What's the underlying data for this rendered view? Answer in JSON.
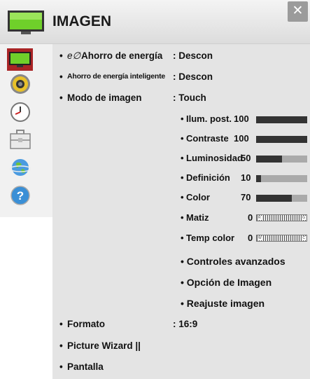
{
  "header": {
    "title": "IMAGEN",
    "close_icon": "close-icon"
  },
  "sidebar": [
    {
      "icon": "tv-picture-icon",
      "active": true
    },
    {
      "icon": "speaker-audio-icon"
    },
    {
      "icon": "clock-time-icon"
    },
    {
      "icon": "toolbox-options-icon"
    },
    {
      "icon": "globe-network-icon"
    },
    {
      "icon": "help-question-icon"
    }
  ],
  "menu": {
    "energy": {
      "bullet": "•",
      "eco": "e∅",
      "label": "Ahorro de energía",
      "value": ": Descon"
    },
    "smart_energy": {
      "bullet": "•",
      "label": "Ahorro de energía inteligente",
      "value": ": Descon"
    },
    "mode": {
      "bullet": "•",
      "label": "Modo de imagen",
      "value": ": Touch"
    },
    "settings": [
      {
        "label": "Ilum. post.",
        "value": "100",
        "level": 1.0
      },
      {
        "label": "Contraste",
        "value": "100",
        "level": 1.0
      },
      {
        "label": "Luminosidad",
        "value": "50",
        "level": 0.5
      },
      {
        "label": "Definición",
        "value": "10",
        "level": 0.1
      },
      {
        "label": "Color",
        "value": "70",
        "level": 0.7
      }
    ],
    "tint": {
      "label": "Matiz",
      "value": "0",
      "left": "R",
      "right": "G"
    },
    "temp": {
      "label": "Temp color",
      "value": "0",
      "left": "W",
      "right": "C"
    },
    "advanced": "Controles avanzados",
    "picture_option": "Opción de Imagen",
    "reset": "Reajuste imagen",
    "format": {
      "label": "Formato",
      "value": ": 16:9"
    },
    "wizard": "Picture Wizard ||",
    "screen": "Pantalla"
  },
  "colors": {
    "accent": "#a92426",
    "bar_fill": "#333333",
    "bar_track": "#aaaaaa",
    "panel": "#e4e4e4"
  }
}
